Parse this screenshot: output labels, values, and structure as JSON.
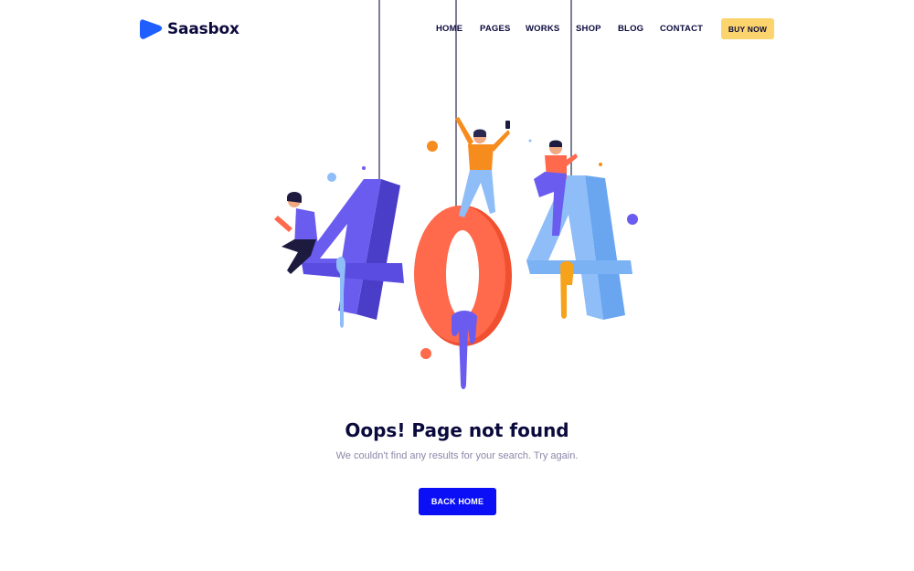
{
  "brand": {
    "name": "Saasbox",
    "logo_icon": "triangle-logo-icon",
    "color": "#1f5eff"
  },
  "nav": {
    "items": [
      {
        "label": "HOME"
      },
      {
        "label": "PAGES"
      },
      {
        "label": "WORKS"
      },
      {
        "label": "SHOP"
      },
      {
        "label": "BLOG"
      },
      {
        "label": "CONTACT"
      }
    ],
    "cta_label": "BUY NOW",
    "cta_color": "#fbd46d"
  },
  "error": {
    "title": "Oops! Page not found",
    "message": "We couldn't find any results for your search. Try again.",
    "button_label": "BACK HOME",
    "button_color": "#0a0ff5"
  },
  "illustration": {
    "name": "404-illustration",
    "colors": {
      "four_left": "#6b5cf0",
      "zero": "#ff6a4d",
      "four_right": "#8ebdf7",
      "navy": "#0b0a3d"
    }
  }
}
